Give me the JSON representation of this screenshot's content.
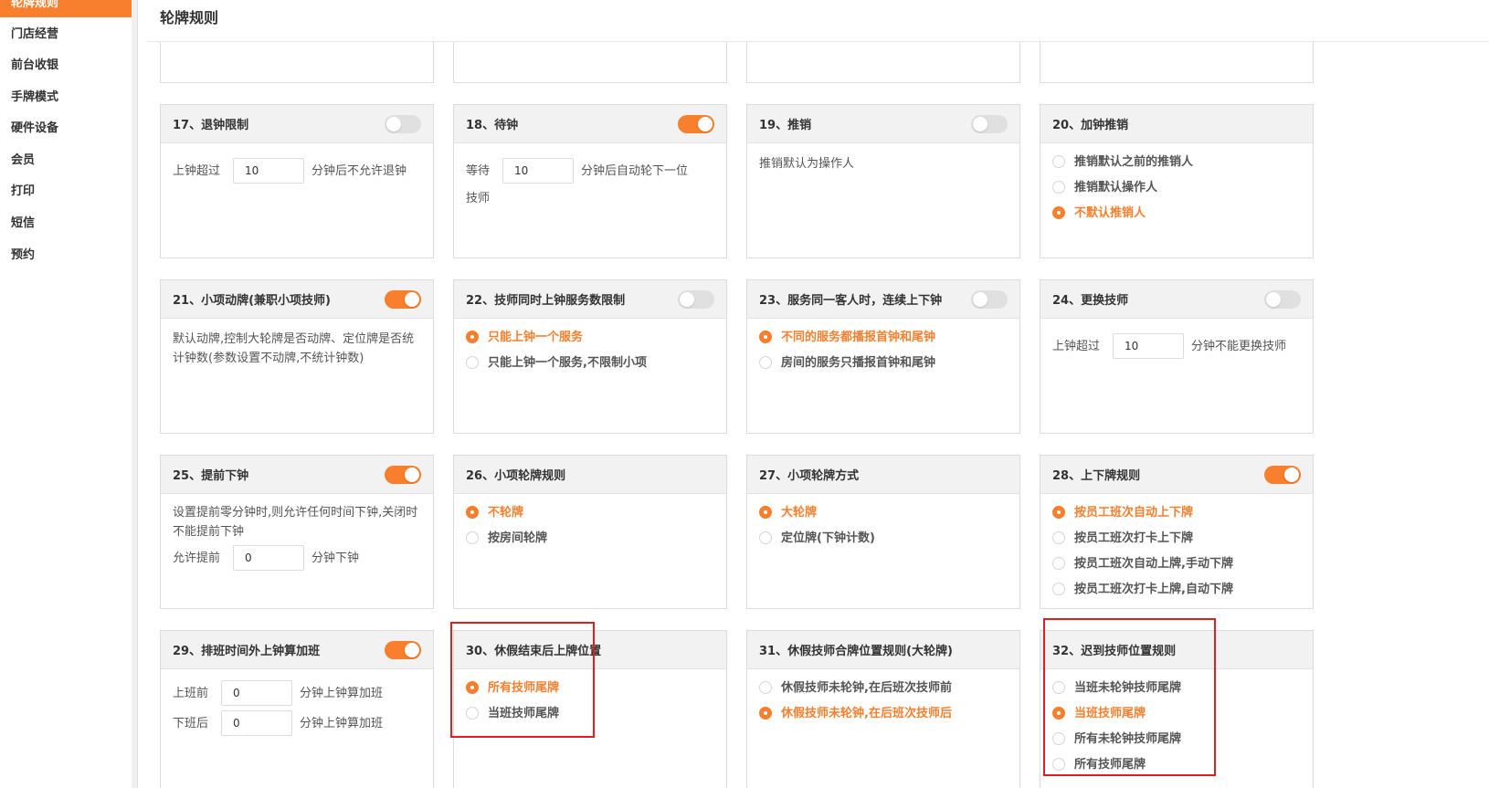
{
  "sidebar": {
    "items": [
      {
        "label": "轮牌规则",
        "active": true
      },
      {
        "label": "门店经营"
      },
      {
        "label": "前台收银"
      },
      {
        "label": "手牌模式"
      },
      {
        "label": "硬件设备"
      },
      {
        "label": "会员"
      },
      {
        "label": "打印"
      },
      {
        "label": "短信"
      },
      {
        "label": "预约"
      }
    ]
  },
  "header": {
    "title": "轮牌规则"
  },
  "cards": {
    "c17": {
      "title": "17、退钟限制",
      "toggle": false,
      "pre": "上钟超过",
      "value": "10",
      "post": "分钟后不允许退钟"
    },
    "c18": {
      "title": "18、待钟",
      "toggle": true,
      "pre": "等待",
      "value": "10",
      "post": "分钟后自动轮下一位",
      "post2": "技师"
    },
    "c19": {
      "title": "19、推销",
      "toggle": false,
      "text": "推销默认为操作人"
    },
    "c20": {
      "title": "20、加钟推销",
      "options": [
        "推销默认之前的推销人",
        "推销默认操作人",
        "不默认推销人"
      ],
      "selected": 2
    },
    "c21": {
      "title": "21、小项动牌(兼职小项技师)",
      "toggle": true,
      "text": "默认动牌,控制大轮牌是否动牌、定位牌是否统计钟数(参数设置不动牌,不统计钟数)"
    },
    "c22": {
      "title": "22、技师同时上钟服务数限制",
      "toggle": false,
      "options": [
        "只能上钟一个服务",
        "只能上钟一个服务,不限制小项"
      ],
      "selected": 0
    },
    "c23": {
      "title": "23、服务同一客人时，连续上下钟",
      "toggle": false,
      "options": [
        "不同的服务都播报首钟和尾钟",
        "房间的服务只播报首钟和尾钟"
      ],
      "selected": 0
    },
    "c24": {
      "title": "24、更换技师",
      "toggle": false,
      "pre": "上钟超过",
      "value": "10",
      "post": "分钟不能更换技师"
    },
    "c25": {
      "title": "25、提前下钟",
      "toggle": true,
      "text": "设置提前零分钟时,则允许任何时间下钟,关闭时不能提前下钟",
      "pre": "允许提前",
      "value": "0",
      "post": "分钟下钟"
    },
    "c26": {
      "title": "26、小项轮牌规则",
      "options": [
        "不轮牌",
        "按房间轮牌"
      ],
      "selected": 0
    },
    "c27": {
      "title": "27、小项轮牌方式",
      "options": [
        "大轮牌",
        "定位牌(下钟计数)"
      ],
      "selected": 0
    },
    "c28": {
      "title": "28、上下牌规则",
      "toggle": true,
      "options": [
        "按员工班次自动上下牌",
        "按员工班次打卡上下牌",
        "按员工班次自动上牌,手动下牌",
        "按员工班次打卡上牌,自动下牌"
      ],
      "selected": 0
    },
    "c29": {
      "title": "29、排班时间外上钟算加班",
      "toggle": true,
      "rows": [
        {
          "pre": "上班前",
          "value": "0",
          "post": "分钟上钟算加班"
        },
        {
          "pre": "下班后",
          "value": "0",
          "post": "分钟上钟算加班"
        }
      ]
    },
    "c30": {
      "title": "30、休假结束后上牌位置",
      "options": [
        "所有技师尾牌",
        "当班技师尾牌"
      ],
      "selected": 0
    },
    "c31": {
      "title": "31、休假技师合牌位置规则(大轮牌)",
      "options": [
        "休假技师未轮钟,在后班次技师前",
        "休假技师未轮钟,在后班次技师后"
      ],
      "selected": 1
    },
    "c32": {
      "title": "32、迟到技师位置规则",
      "options": [
        "当班未轮钟技师尾牌",
        "当班技师尾牌",
        "所有未轮钟技师尾牌",
        "所有技师尾牌"
      ],
      "selected": 1
    }
  },
  "colors": {
    "accent": "#f77f2d",
    "highlight": "#e02020"
  }
}
